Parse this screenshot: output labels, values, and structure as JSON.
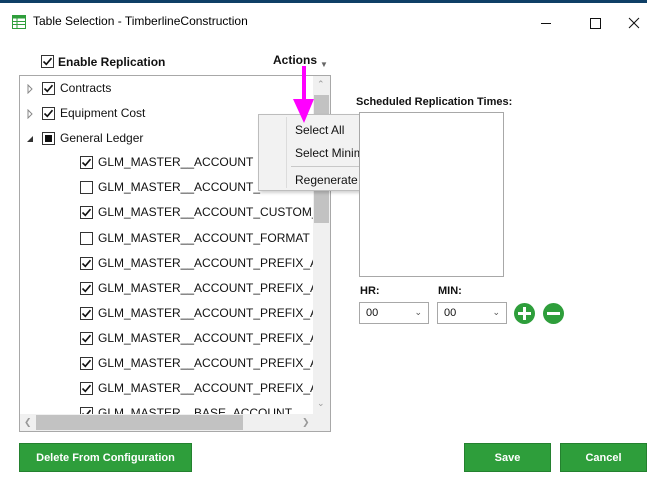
{
  "window": {
    "title": "Table Selection - TimberlineConstruction",
    "controls": {
      "minimize": "—",
      "maximize": "☐",
      "close": "✕"
    }
  },
  "enable_replication": {
    "label": "Enable Replication",
    "checked": true
  },
  "actions": {
    "label": "Actions"
  },
  "tree": {
    "groups": [
      {
        "label": "Contracts",
        "state": "checked",
        "expanded": false
      },
      {
        "label": "Equipment Cost",
        "state": "checked",
        "expanded": false
      },
      {
        "label": "General Ledger",
        "state": "partial",
        "expanded": true
      }
    ],
    "items": [
      {
        "label": "GLM_MASTER__ACCOUNT",
        "checked": true
      },
      {
        "label": "GLM_MASTER__ACCOUNT_ACT",
        "checked": false
      },
      {
        "label": "GLM_MASTER__ACCOUNT_CUSTOM_FIELD",
        "checked": true
      },
      {
        "label": "GLM_MASTER__ACCOUNT_FORMAT",
        "checked": false
      },
      {
        "label": "GLM_MASTER__ACCOUNT_PREFIX_A",
        "checked": true
      },
      {
        "label": "GLM_MASTER__ACCOUNT_PREFIX_A_CUST",
        "checked": true
      },
      {
        "label": "GLM_MASTER__ACCOUNT_PREFIX_AB",
        "checked": true
      },
      {
        "label": "GLM_MASTER__ACCOUNT_PREFIX_AB_CUS",
        "checked": true
      },
      {
        "label": "GLM_MASTER__ACCOUNT_PREFIX_ABC",
        "checked": true
      },
      {
        "label": "GLM_MASTER__ACCOUNT_PREFIX_ABC_CU",
        "checked": true
      },
      {
        "label": "GLM_MASTER__BASE_ACCOUNT",
        "checked": true
      }
    ]
  },
  "context_menu": {
    "items": [
      "Select All",
      "Select Minimal",
      "Regenerate Tables"
    ]
  },
  "schedule": {
    "label": "Scheduled Replication Times:",
    "hr_label": "HR:",
    "min_label": "MIN:",
    "hr_value": "00",
    "min_value": "00"
  },
  "buttons": {
    "delete": "Delete From Configuration",
    "save": "Save",
    "cancel": "Cancel"
  },
  "colors": {
    "accent_green": "#2e9e3b",
    "annotation_arrow": "#ff00ff",
    "title_accent": "#0f3f66"
  },
  "icons": {
    "app": "table-grid-icon",
    "add": "plus-circle-icon",
    "remove": "minus-circle-icon"
  }
}
